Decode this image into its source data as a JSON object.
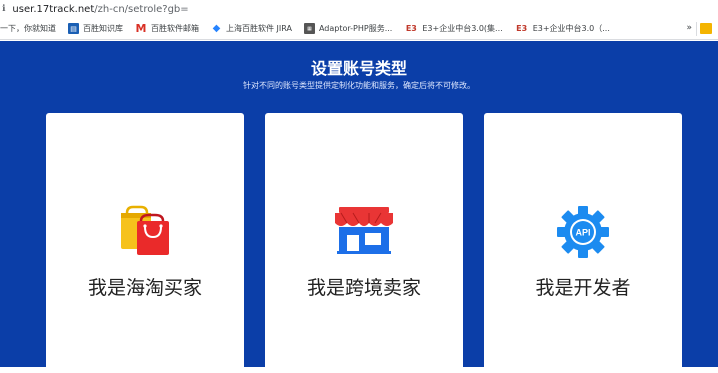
{
  "browser": {
    "url_host": "user.17track.net",
    "url_path": "/zh-cn/setrole?gb=",
    "bookmarks": [
      {
        "label": "一下，你就知道",
        "icon": "none"
      },
      {
        "label": "百胜知识库",
        "icon": "knowledge-base-icon"
      },
      {
        "label": "百胜软件邮箱",
        "icon": "gmail-icon"
      },
      {
        "label": "上海百胜软件 JIRA",
        "icon": "jira-icon"
      },
      {
        "label": "Adaptor-PHP服务...",
        "icon": "adaptor-icon"
      },
      {
        "label": "E3+企业中台3.0(集...",
        "icon": "e3-icon"
      },
      {
        "label": "E3+企业中台3.0（...",
        "icon": "e3-icon"
      }
    ],
    "more_label": "»"
  },
  "page": {
    "title": "设置账号类型",
    "subtitle": "针对不同的账号类型提供定制化功能和服务，确定后将不可修改。",
    "background_color": "#0b3ea8",
    "cards": [
      {
        "label": "我是海淘买家",
        "icon": "shopping-bags-icon"
      },
      {
        "label": "我是跨境卖家",
        "icon": "storefront-icon"
      },
      {
        "label": "我是开发者",
        "icon": "api-gear-icon"
      }
    ]
  }
}
